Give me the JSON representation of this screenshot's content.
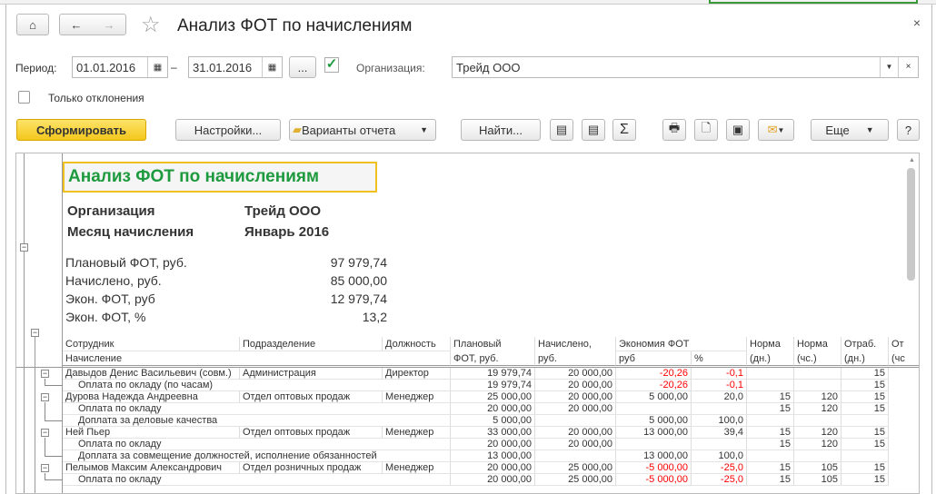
{
  "window": {
    "title": "Анализ ФОТ по начислениям",
    "close": "×"
  },
  "nav": {
    "home": "⌂",
    "back": "←",
    "forward": "→",
    "star": "☆"
  },
  "filters": {
    "period_label": "Период:",
    "date_from": "01.01.2016",
    "dash": "–",
    "date_to": "31.01.2016",
    "more": "...",
    "org_label": "Организация:",
    "org_value": "Трейд ООО",
    "only_deviations": "Только отклонения",
    "org_checked": true,
    "deviations_checked": false
  },
  "toolbar": {
    "generate": "Сформировать",
    "settings": "Настройки...",
    "variants": "Варианты отчета",
    "find": "Найти...",
    "sum": "Σ",
    "more": "Еще",
    "help": "?"
  },
  "report": {
    "title": "Анализ ФОТ по начислениям",
    "org_label": "Организация",
    "org_value": "Трейд ООО",
    "month_label": "Месяц начисления",
    "month_value": "Январь 2016",
    "summary": [
      {
        "label": "Плановый ФОТ, руб.",
        "value": "97 979,74"
      },
      {
        "label": "Начислено, руб.",
        "value": "85 000,00"
      },
      {
        "label": "Экон. ФОТ, руб",
        "value": "12 979,74"
      },
      {
        "label": "Экон. ФОТ, %",
        "value": "13,2"
      }
    ],
    "headers": {
      "employee": "Сотрудник",
      "accrual": "Начисление",
      "department": "Подразделение",
      "position": "Должность",
      "plan1": "Плановый",
      "plan2": "ФОТ, руб.",
      "accrued1": "Начислено,",
      "accrued2": "руб.",
      "economy": "Экономия ФОТ",
      "econ_rub": "руб",
      "econ_pct": "%",
      "norm_days1": "Норма",
      "norm_days2": "(дн.)",
      "norm_hours1": "Норма",
      "norm_hours2": "(чс.)",
      "worked_days1": "Отраб.",
      "worked_days2": "(дн.)",
      "worked_hours1": "От",
      "worked_hours2": "(чс"
    },
    "rows": [
      {
        "level": 0,
        "name": "Давыдов Денис Васильевич (совм.)",
        "dept": "Администрация",
        "pos": "Директор",
        "plan": "19 979,74",
        "acc": "20 000,00",
        "er": "-20,26",
        "ep": "-0,1",
        "nd": "",
        "nh": "",
        "wd": "15",
        "neg": true
      },
      {
        "level": 1,
        "name": "Оплата по окладу (по часам)",
        "dept": "",
        "pos": "",
        "plan": "19 979,74",
        "acc": "20 000,00",
        "er": "-20,26",
        "ep": "-0,1",
        "nd": "",
        "nh": "",
        "wd": "15",
        "neg": true
      },
      {
        "level": 0,
        "name": "Дурова Надежда Андреевна",
        "dept": "Отдел оптовых продаж",
        "pos": "Менеджер",
        "plan": "25 000,00",
        "acc": "20 000,00",
        "er": "5 000,00",
        "ep": "20,0",
        "nd": "15",
        "nh": "120",
        "wd": "15",
        "neg": false
      },
      {
        "level": 1,
        "name": "Оплата по окладу",
        "dept": "",
        "pos": "",
        "plan": "20 000,00",
        "acc": "20 000,00",
        "er": "",
        "ep": "",
        "nd": "15",
        "nh": "120",
        "wd": "15",
        "neg": false
      },
      {
        "level": 1,
        "name": "Доплата за деловые качества",
        "dept": "",
        "pos": "",
        "plan": "5 000,00",
        "acc": "",
        "er": "5 000,00",
        "ep": "100,0",
        "nd": "",
        "nh": "",
        "wd": "",
        "neg": false
      },
      {
        "level": 0,
        "name": "Ней Пьер",
        "dept": "Отдел оптовых продаж",
        "pos": "Менеджер",
        "plan": "33 000,00",
        "acc": "20 000,00",
        "er": "13 000,00",
        "ep": "39,4",
        "nd": "15",
        "nh": "120",
        "wd": "15",
        "neg": false
      },
      {
        "level": 1,
        "name": "Оплата по окладу",
        "dept": "",
        "pos": "",
        "plan": "20 000,00",
        "acc": "20 000,00",
        "er": "",
        "ep": "",
        "nd": "15",
        "nh": "120",
        "wd": "15",
        "neg": false
      },
      {
        "level": 1,
        "name": "Доплата за совмещение должностей, исполнение обязанностей",
        "dept": "",
        "pos": "",
        "plan": "13 000,00",
        "acc": "",
        "er": "13 000,00",
        "ep": "100,0",
        "nd": "",
        "nh": "",
        "wd": "",
        "neg": false
      },
      {
        "level": 0,
        "name": "Пелымов Максим Александрович",
        "dept": "Отдел розничных продаж",
        "pos": "Менеджер",
        "plan": "20 000,00",
        "acc": "25 000,00",
        "er": "-5 000,00",
        "ep": "-25,0",
        "nd": "15",
        "nh": "105",
        "wd": "15",
        "neg": true
      },
      {
        "level": 1,
        "name": "Оплата по окладу",
        "dept": "",
        "pos": "",
        "plan": "20 000,00",
        "acc": "25 000,00",
        "er": "-5 000,00",
        "ep": "-25,0",
        "nd": "15",
        "nh": "105",
        "wd": "15",
        "neg": true
      }
    ]
  },
  "colors": {
    "accent": "#f5c518",
    "title_green": "#1e9a3e",
    "negative": "#ff0000"
  }
}
